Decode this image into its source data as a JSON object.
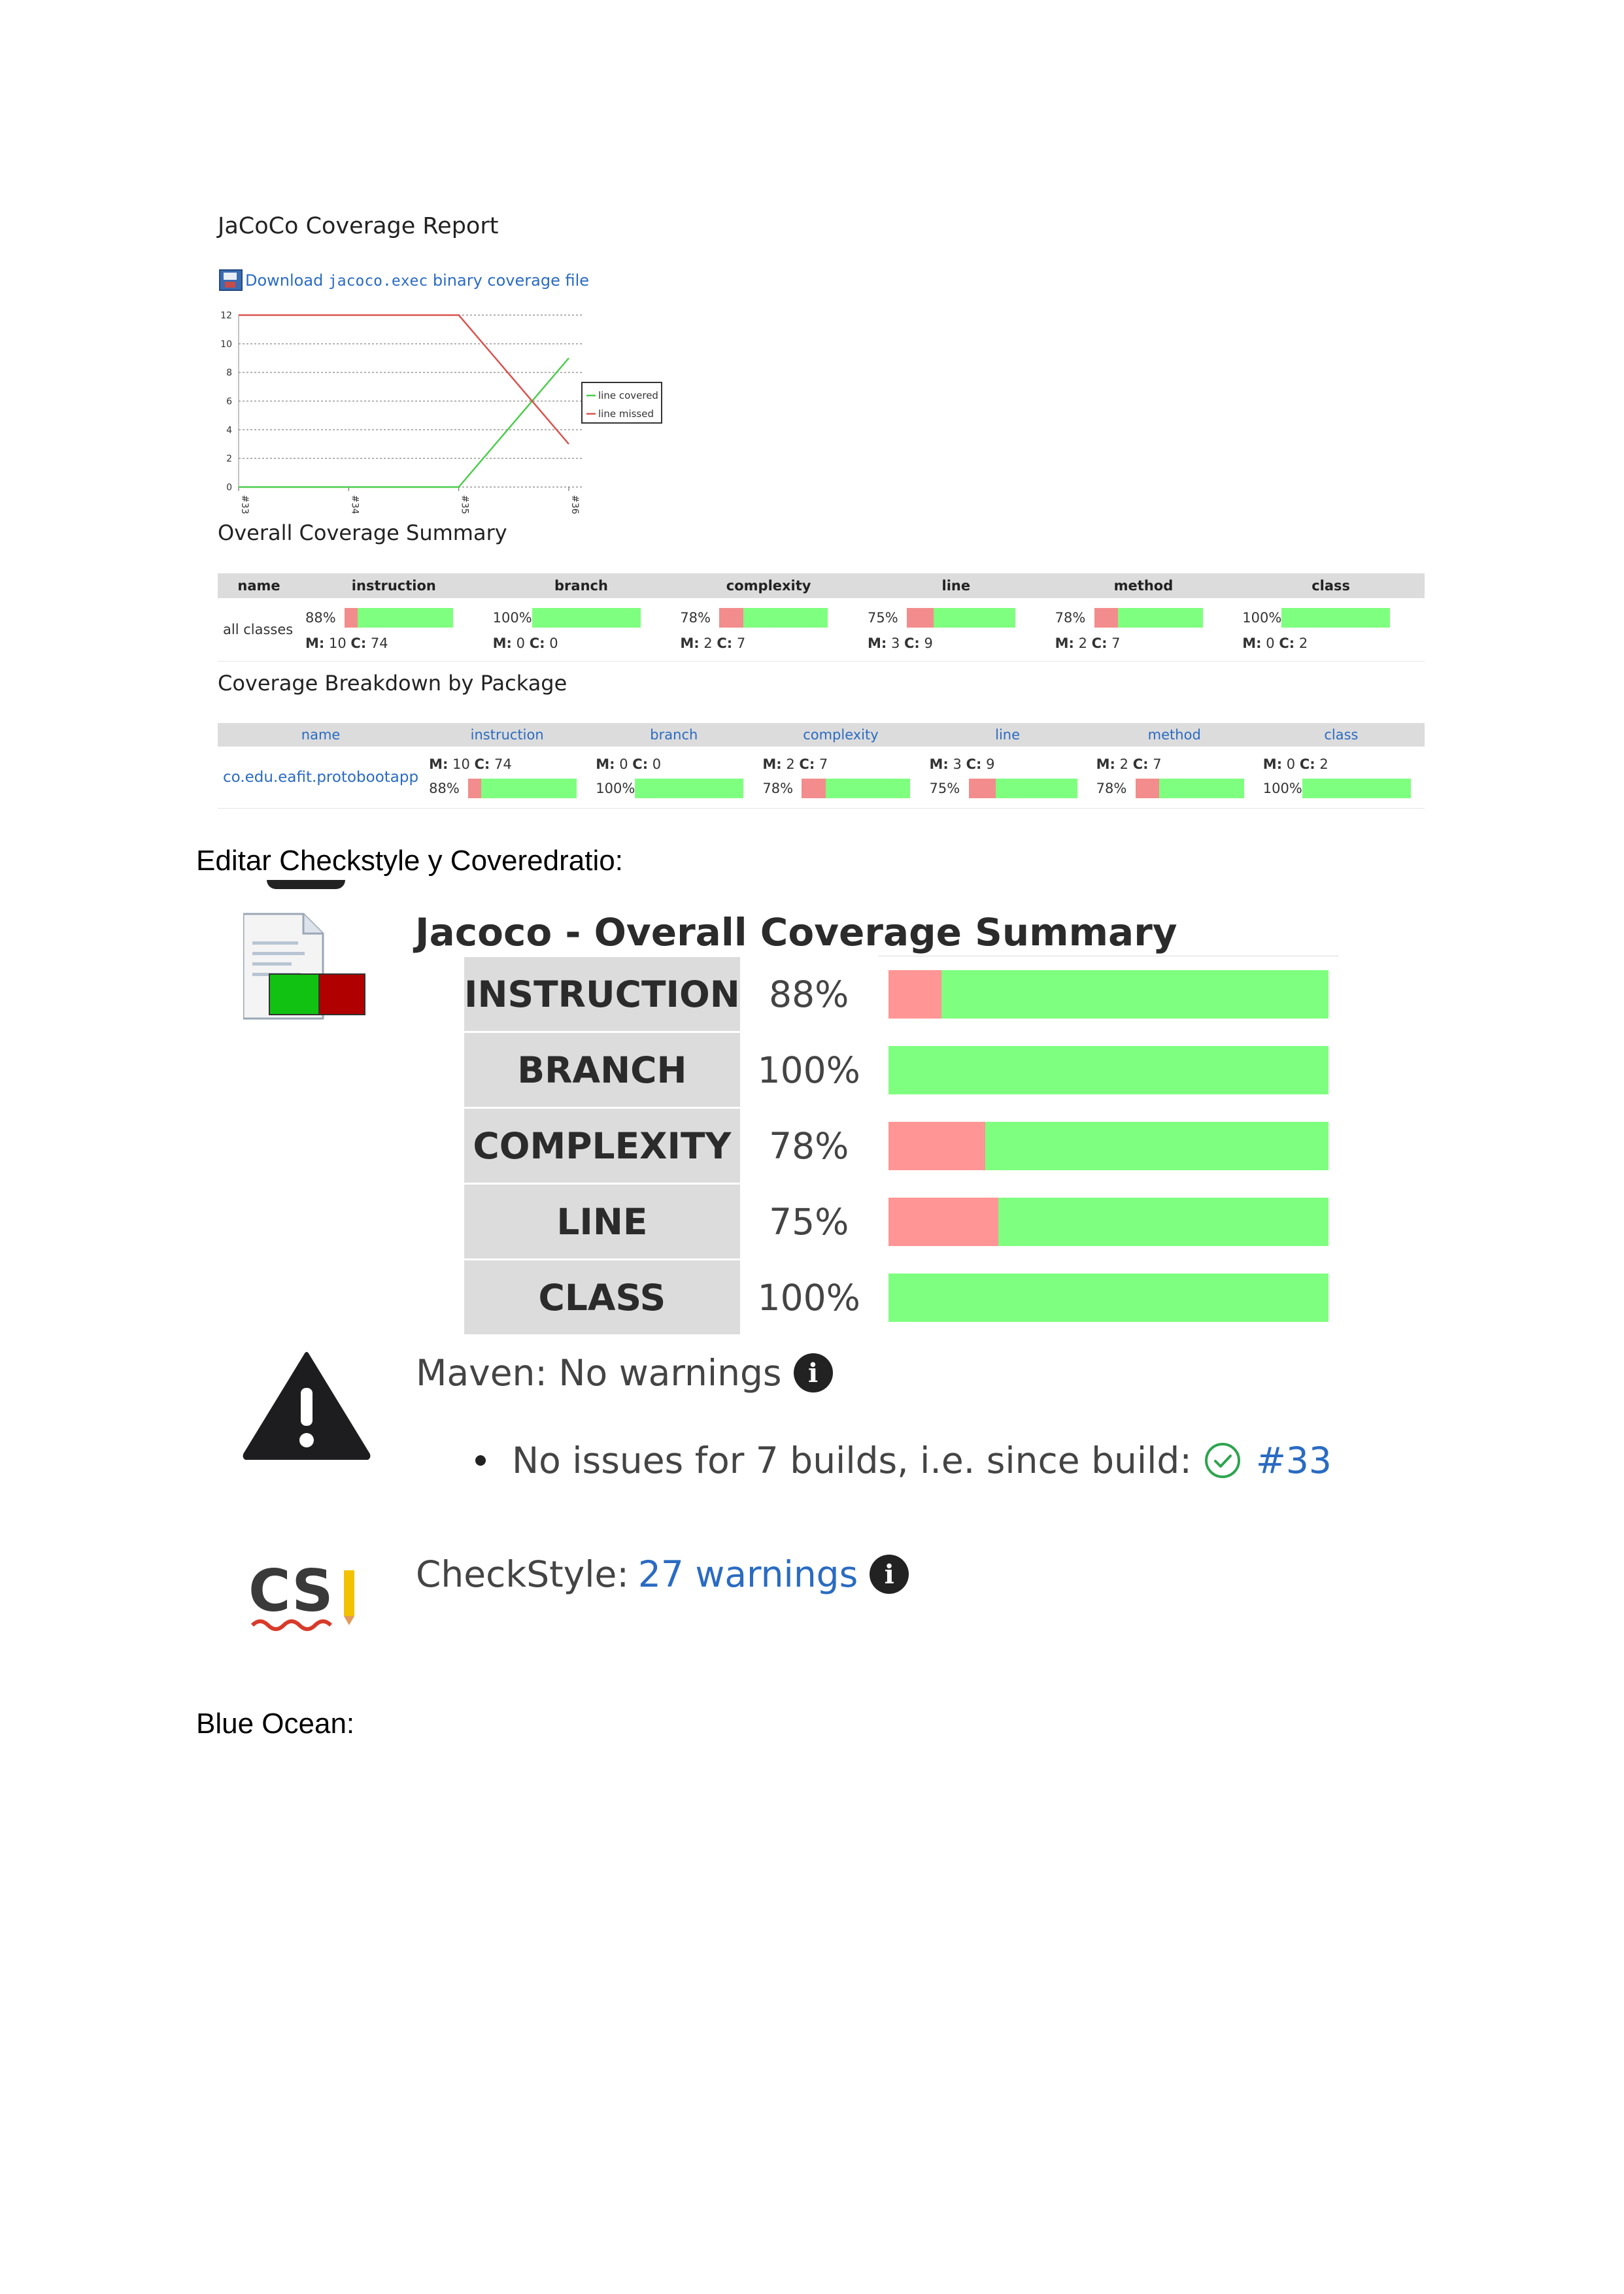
{
  "jacoco_report": {
    "title": "JaCoCo Coverage Report",
    "download": {
      "prefix": "Download ",
      "code": "jacoco.exec",
      "suffix": " binary coverage file"
    },
    "trend_chart": {
      "y_ticks": [
        "0",
        "2",
        "4",
        "6",
        "8",
        "10",
        "12"
      ],
      "x_ticks": [
        "#33",
        "#34",
        "#35",
        "#36"
      ],
      "legend": [
        "line covered",
        "line missed"
      ]
    },
    "summary_heading": "Overall Coverage Summary",
    "summary_table": {
      "headers": [
        "name",
        "instruction",
        "branch",
        "complexity",
        "line",
        "method",
        "class"
      ],
      "row_name": "all classes",
      "cells": [
        {
          "pct": "88%",
          "m": "10",
          "c": "74",
          "missed_frac": 0.12
        },
        {
          "pct": "100%",
          "m": "0",
          "c": "0",
          "missed_frac": 0.0
        },
        {
          "pct": "78%",
          "m": "2",
          "c": "7",
          "missed_frac": 0.22
        },
        {
          "pct": "75%",
          "m": "3",
          "c": "9",
          "missed_frac": 0.25
        },
        {
          "pct": "78%",
          "m": "2",
          "c": "7",
          "missed_frac": 0.22
        },
        {
          "pct": "100%",
          "m": "0",
          "c": "2",
          "missed_frac": 0.0
        }
      ]
    },
    "breakdown_heading": "Coverage Breakdown by Package",
    "breakdown_table": {
      "headers": [
        "name",
        "instruction",
        "branch",
        "complexity",
        "line",
        "method",
        "class"
      ],
      "package": "co.edu.eafit.protobootapp",
      "cells": [
        {
          "pct": "88%",
          "m": "10",
          "c": "74",
          "missed_frac": 0.12
        },
        {
          "pct": "100%",
          "m": "0",
          "c": "0",
          "missed_frac": 0.0
        },
        {
          "pct": "78%",
          "m": "2",
          "c": "7",
          "missed_frac": 0.22
        },
        {
          "pct": "75%",
          "m": "3",
          "c": "9",
          "missed_frac": 0.25
        },
        {
          "pct": "78%",
          "m": "2",
          "c": "7",
          "missed_frac": 0.22
        },
        {
          "pct": "100%",
          "m": "0",
          "c": "2",
          "missed_frac": 0.0
        }
      ]
    }
  },
  "chart_data": {
    "type": "line",
    "x": [
      "#33",
      "#34",
      "#35",
      "#36"
    ],
    "series": [
      {
        "name": "line covered",
        "values": [
          0,
          0,
          0,
          9
        ],
        "color": "#4ccd4c"
      },
      {
        "name": "line missed",
        "values": [
          12,
          12,
          12,
          3
        ],
        "color": "#d9534f"
      }
    ],
    "ylim": [
      0,
      12
    ],
    "grid": true,
    "legend_position": "right"
  },
  "doc": {
    "editar_heading": "Editar Checkstyle y Coveredratio:",
    "blue_ocean_heading": "Blue Ocean:"
  },
  "overall": {
    "title": "Jacoco - Overall Coverage Summary",
    "rows": [
      {
        "label": "INSTRUCTION",
        "pct": "88%",
        "missed_frac": 0.12
      },
      {
        "label": "BRANCH",
        "pct": "100%",
        "missed_frac": 0.0
      },
      {
        "label": "COMPLEXITY",
        "pct": "78%",
        "missed_frac": 0.22
      },
      {
        "label": "LINE",
        "pct": "75%",
        "missed_frac": 0.25
      },
      {
        "label": "CLASS",
        "pct": "100%",
        "missed_frac": 0.0
      }
    ]
  },
  "maven": {
    "label": "Maven: No warnings",
    "issues_text": "No issues for 7 builds, i.e. since build:",
    "build_link": "#33"
  },
  "checkstyle": {
    "label": "CheckStyle:",
    "link": "27 warnings",
    "icon_text": "CS"
  },
  "colors": {
    "missed": "#f38c8c",
    "covered": "#7fff7f",
    "link": "#2a6bc2",
    "header_bg": "#dcdcdc"
  }
}
